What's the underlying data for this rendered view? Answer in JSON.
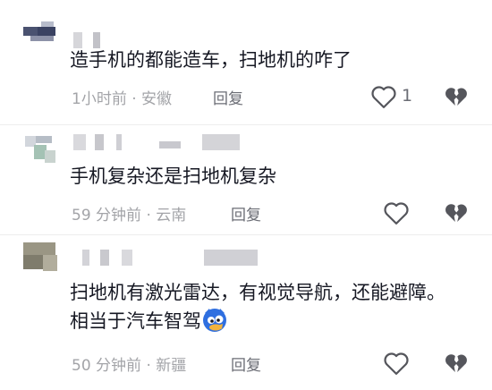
{
  "comments": [
    {
      "text": "造手机的都能造车，扫地机的咋了",
      "time": "1小时前",
      "location": "安徽",
      "reply_label": "回复",
      "like_count": "1"
    },
    {
      "text": "手机复杂还是扫地机复杂",
      "time": "59 分钟前",
      "location": "云南",
      "reply_label": "回复"
    },
    {
      "text": "扫地机有激光雷达，有视觉导航，还能避障。相当于汽车智驾",
      "time": "50 分钟前",
      "location": "新疆",
      "reply_label": "回复",
      "emoji": "blue-cat-emoji"
    }
  ],
  "meta_separator": " · ",
  "icons": {
    "like": "heart-outline-icon",
    "dislike": "broken-heart-icon"
  },
  "colors": {
    "text": "#161823",
    "meta": "#a3a4a8",
    "reply": "#6b6d75",
    "icon": "#55565c"
  }
}
